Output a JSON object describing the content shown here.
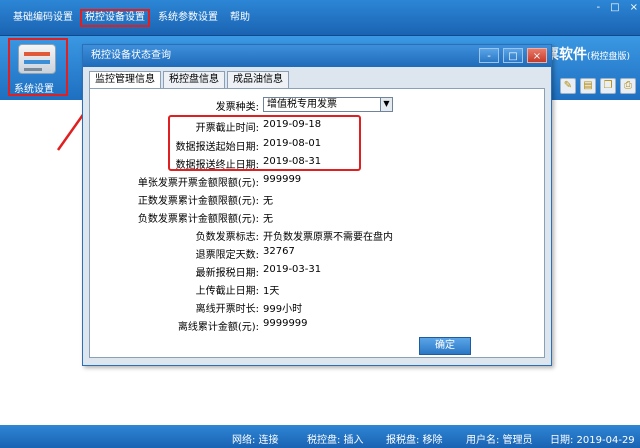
{
  "menu": [
    "基础编码设置",
    "税控设备设置",
    "系统参数设置",
    "帮助"
  ],
  "window_controls": [
    "-",
    "□",
    "×"
  ],
  "sidebar": {
    "system_settings_label": "系统设置"
  },
  "brand": {
    "title": "票软件",
    "subtitle": "(税控盘版)"
  },
  "dialog": {
    "title": "税控设备状态查询",
    "controls": [
      "-",
      "□",
      "×"
    ],
    "tabs": [
      "监控管理信息",
      "税控盘信息",
      "成品油信息"
    ],
    "invoice_type_label": "发票种类:",
    "invoice_type_value": "增值税专用发票",
    "rows": [
      {
        "label": "开票截止时间:",
        "value": "2019-09-18"
      },
      {
        "label": "数据报送起始日期:",
        "value": "2019-08-01"
      },
      {
        "label": "数据报送终止日期:",
        "value": "2019-08-31"
      },
      {
        "label": "单张发票开票金额限额(元):",
        "value": "999999"
      },
      {
        "label": "正数发票累计金额限额(元):",
        "value": "无"
      },
      {
        "label": "负数发票累计金额限额(元):",
        "value": "无"
      },
      {
        "label": "负数发票标志:",
        "value": "开负数发票原票不需要在盘内"
      },
      {
        "label": "退票限定天数:",
        "value": "32767"
      },
      {
        "label": "最新报税日期:",
        "value": "2019-03-31"
      },
      {
        "label": "上传截止日期:",
        "value": "1天"
      },
      {
        "label": "离线开票时长:",
        "value": "999小时"
      },
      {
        "label": "离线累计金额(元):",
        "value": "9999999"
      }
    ],
    "ok_button": "确定"
  },
  "status": {
    "network": "网络: 连接",
    "tax_disk": "税控盘: 插入",
    "report_disk": "报税盘: 移除",
    "user": "用户名: 管理员",
    "date": "日期: 2019-04-29"
  },
  "colors": {
    "accent": "#1f6bb9",
    "highlight": "#e02020"
  }
}
